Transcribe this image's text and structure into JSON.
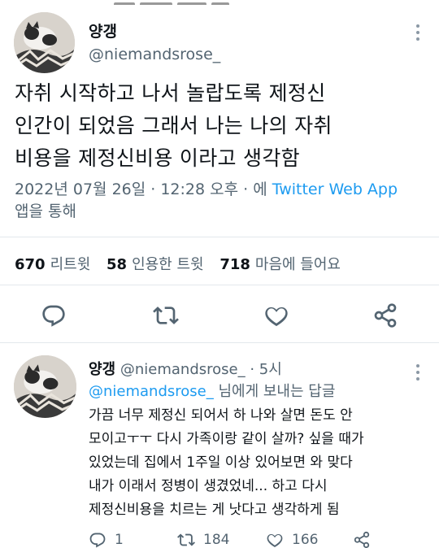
{
  "tweet": {
    "author_name": "양갱",
    "author_handle": "@niemandsrose_",
    "text_lines": [
      "자취 시작하고 나서 놀랍도록 제정신",
      "인간이 되었음 그래서 나는 나의 자취",
      "비용을 제정신비용 이라고 생각함"
    ],
    "timestamp": "2022년 07월 26일 · 12:28 오후 · 에",
    "source": "Twitter Web App",
    "source_suffix": "앱을 통해",
    "stats": {
      "retweets_count": "670",
      "retweets_label": "리트윗",
      "quotes_count": "58",
      "quotes_label": "인용한 트윗",
      "likes_count": "718",
      "likes_label": "마음에 들어요"
    },
    "actions": {
      "reply_icon": "comment-icon",
      "retweet_icon": "retweet-icon",
      "like_icon": "heart-icon",
      "share_icon": "share-icon"
    }
  },
  "reply": {
    "author_name": "양갱",
    "author_handle": "@niemandsrose_",
    "time": "· 5시",
    "replying_to_mention": "@niemandsrose_",
    "replying_to_suffix": "님에게 보내는 답글",
    "text_lines": [
      "가끔 너무 제정신 되어서 하 나와 살면 돈도 안",
      "모이고ㅜㅜ 다시 가족이랑 같이 살까? 싶을 때가",
      "있었는데 집에서 1주일 이상 있어보면 와 맞다",
      "내가 이래서 정병이 생겼었네... 하고 다시",
      "제정신비용을 치르는 게 낫다고 생각하게 됨"
    ],
    "reply_count": "1",
    "retweet_count": "184",
    "like_count": "166"
  },
  "colors": {
    "text": "#0f1419",
    "secondary": "#536471",
    "accent": "#1d9bf0",
    "divider": "#e3e8ec"
  }
}
